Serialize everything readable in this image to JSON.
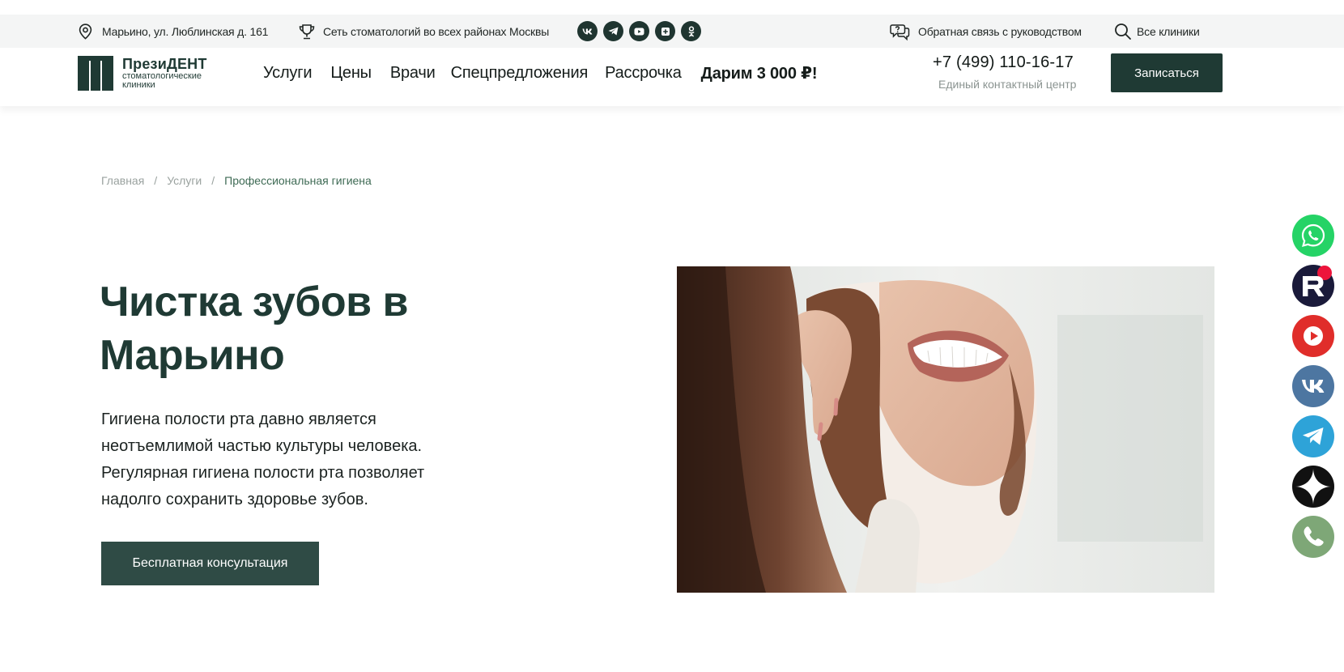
{
  "topbar": {
    "address": "Марьино, ул. Люблинская д. 161",
    "network": "Сеть стоматологий во всех районах Москвы",
    "socials": [
      "vk-icon",
      "telegram-icon",
      "youtube-icon",
      "rutube-icon",
      "odnoklassniki-icon"
    ],
    "feedback": "Обратная связь с руководством",
    "clinics": "Все клиники"
  },
  "header": {
    "logo_name": "ПрезиДЕНТ",
    "logo_sub_1": "стоматологические",
    "logo_sub_2": "клиники",
    "nav": [
      "Услуги",
      "Цены",
      "Врачи",
      "Спецпредложения",
      "Рассрочка"
    ],
    "promo": "Дарим 3 000 ₽!",
    "phone": "+7 (499) 110-16-17",
    "phone_caption": "Единый контактный центр",
    "book_label": "Записаться"
  },
  "breadcrumb": {
    "items": [
      "Главная",
      "Услуги"
    ],
    "separator": "/",
    "current": "Профессиональная гигиена"
  },
  "hero": {
    "title_line1": "Чистка зубов в",
    "title_line2": "Марьино",
    "text_lines": [
      "Гигиена полости рта давно является",
      "неотъемлимой частью культуры человека.",
      "Регулярная гигиена полости рта позволяет",
      "надолго сохранить здоровье зубов."
    ],
    "cta_label": "Бесплатная консультация"
  },
  "floating": [
    "whatsapp-icon",
    "rutube-icon",
    "youtube-icon",
    "vk-icon",
    "telegram-icon",
    "dzen-icon",
    "phone-icon"
  ],
  "colors": {
    "brand_dark": "#1f3a34",
    "cta": "#2f4b45",
    "breadcrumb_current": "#3f6b55",
    "topbar_bg": "#f4f5f5"
  }
}
